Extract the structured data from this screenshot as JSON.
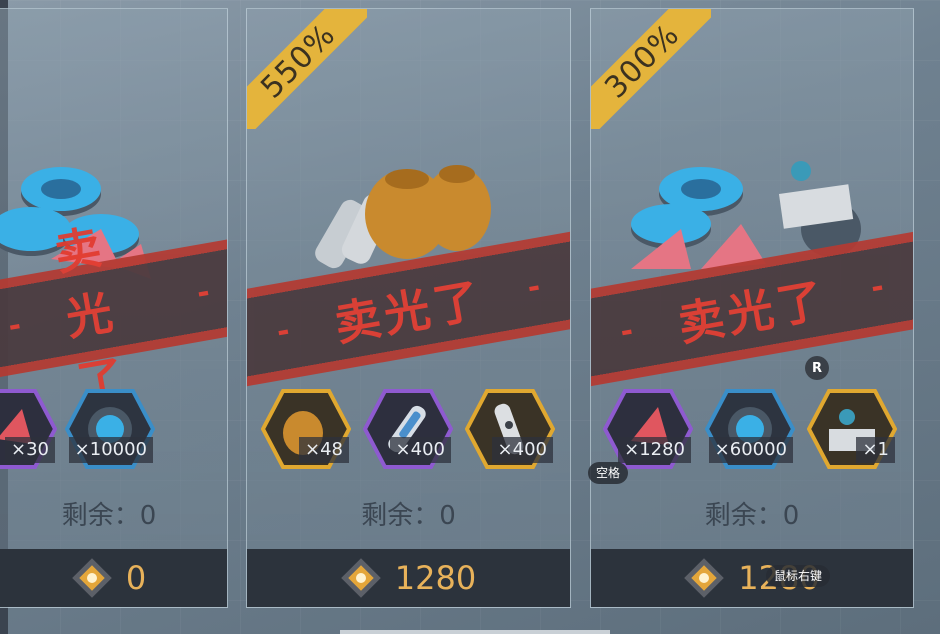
{
  "sold_out_label": "卖光了",
  "currency_icon": "chip-token-icon",
  "cards": [
    {
      "bonus": "",
      "items": [
        {
          "icon": "red-crystal-icon",
          "qty": "×30",
          "frame": "#8e5ad0"
        },
        {
          "icon": "blue-orb-icon",
          "qty": "×10000",
          "frame": "#3a8ec8"
        }
      ],
      "remaining": "剩余：0",
      "price": "0"
    },
    {
      "bonus": "550%",
      "items": [
        {
          "icon": "gold-bag-icon",
          "qty": "×48",
          "frame": "#e0a830"
        },
        {
          "icon": "blue-capsule-icon",
          "qty": "×400",
          "frame": "#8e5ad0"
        },
        {
          "icon": "white-capsule-icon",
          "qty": "×400",
          "frame": "#e0a830"
        }
      ],
      "remaining": "剩余：0",
      "price": "1280"
    },
    {
      "bonus": "300%",
      "items": [
        {
          "icon": "red-crystal-icon",
          "qty": "×1280",
          "frame": "#8e5ad0"
        },
        {
          "icon": "blue-orb-icon",
          "qty": "×60000",
          "frame": "#3a8ec8"
        },
        {
          "icon": "blueprint-book-icon",
          "qty": "×1",
          "frame": "#e0a830"
        }
      ],
      "remaining": "剩余：0",
      "price": "1280"
    }
  ],
  "hints": {
    "r_key": "R",
    "space_key": "空格",
    "right_click": "鼠标右键"
  }
}
